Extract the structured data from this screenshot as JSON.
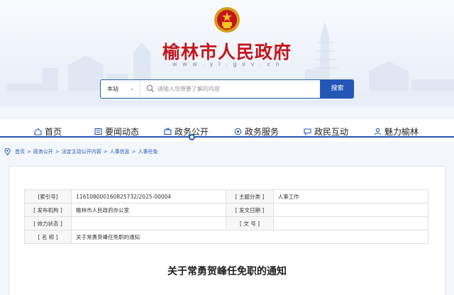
{
  "header": {
    "site_title": "榆林市人民政府",
    "site_url": "w w w . y l . g o v . c n",
    "emblem_icon": "national-emblem-icon"
  },
  "search": {
    "scope": "本站",
    "placeholder": "请输入您想要了解的内容",
    "button": "搜索"
  },
  "nav": {
    "items": [
      {
        "label": "首页",
        "icon": "home-icon"
      },
      {
        "label": "要闻动态",
        "icon": "news-icon"
      },
      {
        "label": "政务公开",
        "icon": "briefcase-icon",
        "active": true
      },
      {
        "label": "政务服务",
        "icon": "service-icon"
      },
      {
        "label": "政民互动",
        "icon": "chat-icon"
      },
      {
        "label": "魅力榆林",
        "icon": "people-icon"
      }
    ]
  },
  "breadcrumb": [
    "首页",
    "政务公开",
    "法定主动公开内容",
    "人事信息",
    "人事任免"
  ],
  "meta": {
    "index_label": "[索引号]",
    "index_value": "116108000160825732/2025-00004",
    "topic_label": "[ 主题分类 ]",
    "topic_value": "人事工作",
    "issuer_label": "[ 发布机构 ]",
    "issuer_value": "榆林市人民政府办公室",
    "date_label": "[ 发文日期 ]",
    "date_value": "",
    "status_label": "[ 效力状态 ]",
    "status_value": "",
    "docno_label": "[ 文 号 ]",
    "docno_value": "",
    "name_label": "[ 名 称 ]",
    "name_value": "关于常勇贺峰任免职的通知"
  },
  "document": {
    "title": "关于常勇贺峰任免职的通知"
  },
  "colors": {
    "brand_red": "#c4161c",
    "brand_blue": "#2456b8"
  }
}
